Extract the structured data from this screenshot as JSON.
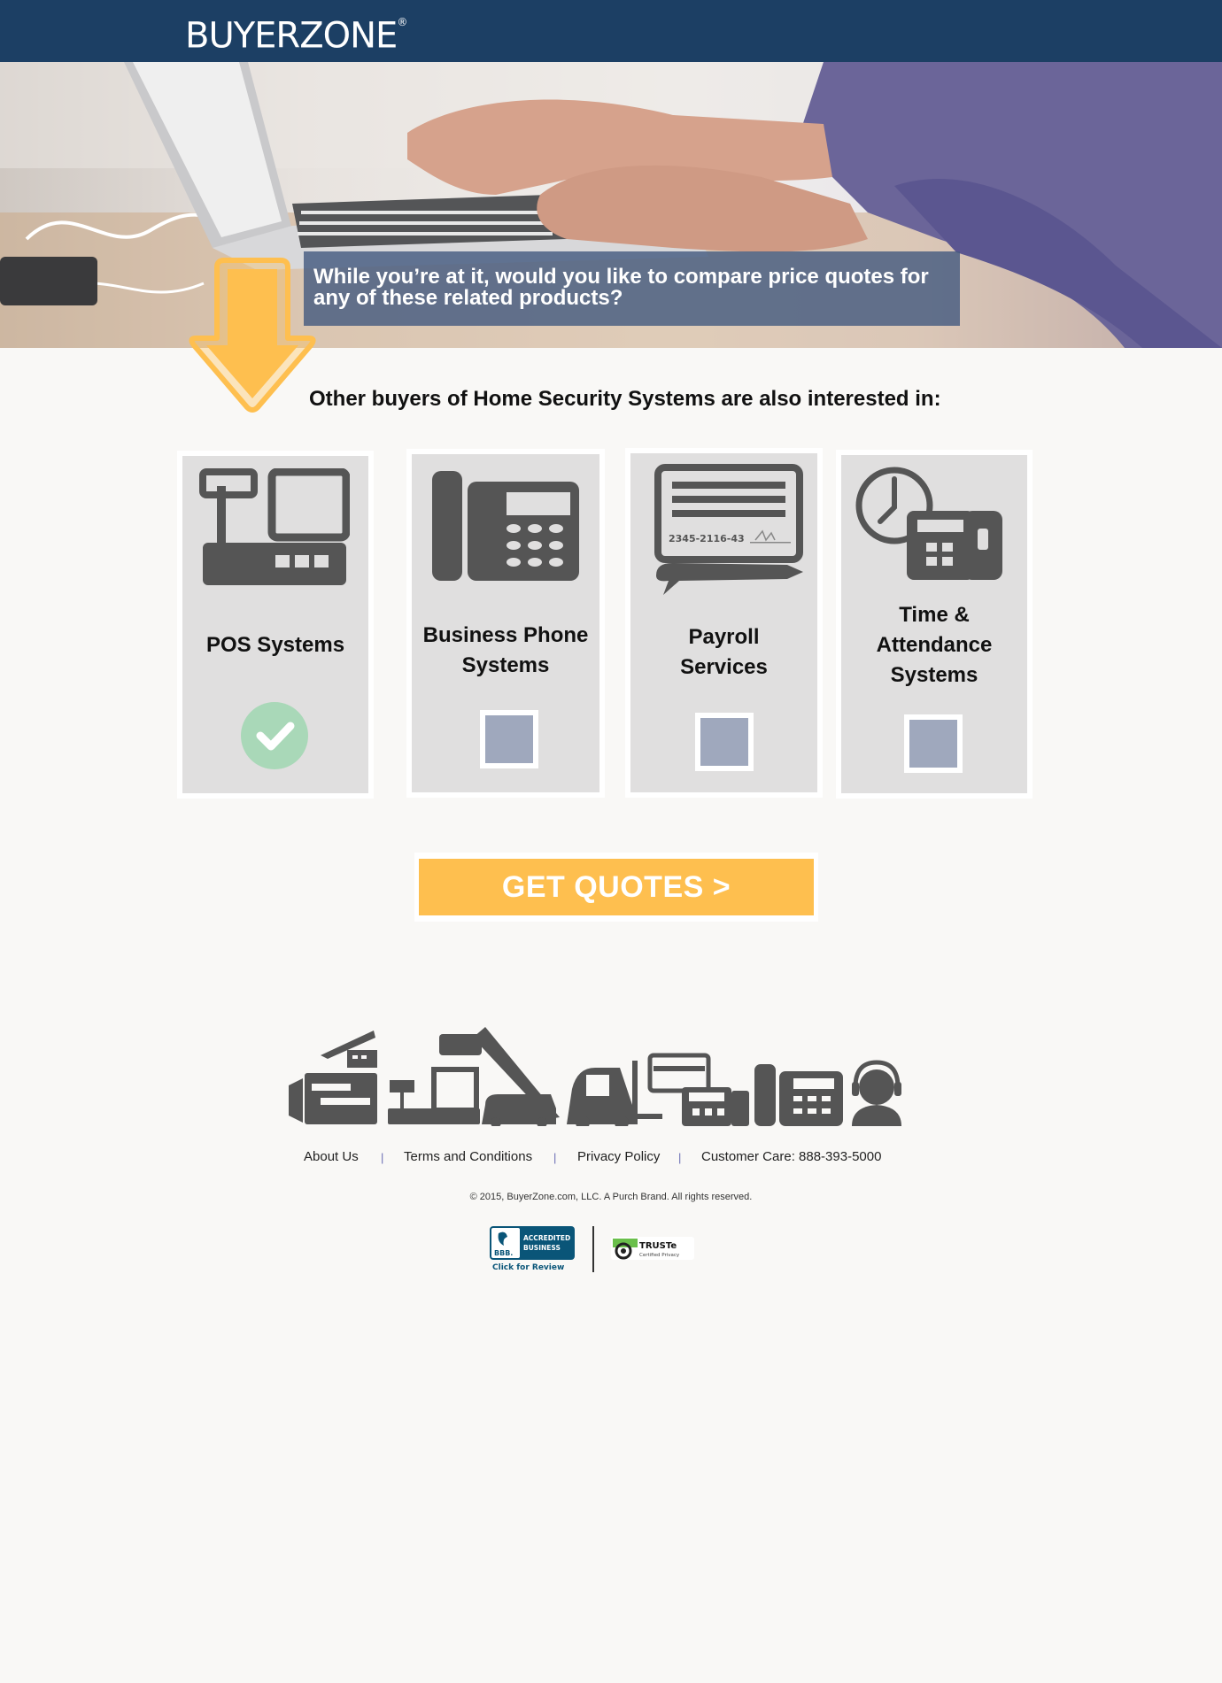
{
  "header": {
    "logo_text": "BUYERZONE",
    "logo_mark": "®"
  },
  "hero": {
    "banner_text": "While you’re at it, would you like to compare price quotes for any of these related products?"
  },
  "subheading": "Other buyers of Home Security Systems are also interested in:",
  "products": [
    {
      "label_lines": [
        "POS Systems"
      ],
      "icon": "pos-terminal-icon",
      "selected": true
    },
    {
      "label_lines": [
        "Business Phone",
        "Systems"
      ],
      "icon": "desk-phone-icon",
      "selected": false
    },
    {
      "label_lines": [
        "Payroll",
        "Services"
      ],
      "icon": "check-and-pen-icon",
      "selected": false,
      "icon_text": "2345-2116-43"
    },
    {
      "label_lines": [
        "Time &",
        "Attendance",
        "Systems"
      ],
      "icon": "clock-and-time-terminal-icon",
      "selected": false
    }
  ],
  "cta": {
    "label": "GET QUOTES >"
  },
  "footer": {
    "links": [
      "About Us",
      "Terms and Conditions",
      "Privacy Policy"
    ],
    "customer_care": "Customer Care: 888-393-5000",
    "separator": "|",
    "copyright": "© 2015, BuyerZone.com, LLC. A Purch Brand. All rights reserved.",
    "bbb_badge": {
      "line1": "ACCREDITED",
      "line2": "BUSINESS",
      "caption": "Click for Review",
      "mark": "BBB."
    },
    "truste_badge": {
      "name": "TRUSTe",
      "caption": "Certified Privacy"
    }
  },
  "colors": {
    "header_bg": "#1c3f64",
    "accent_orange": "#febf4f",
    "card_bg": "#e0dfdf",
    "checkbox": "#9fa8bd",
    "check_green": "#a9d8b8",
    "icon_gray": "#555555"
  }
}
